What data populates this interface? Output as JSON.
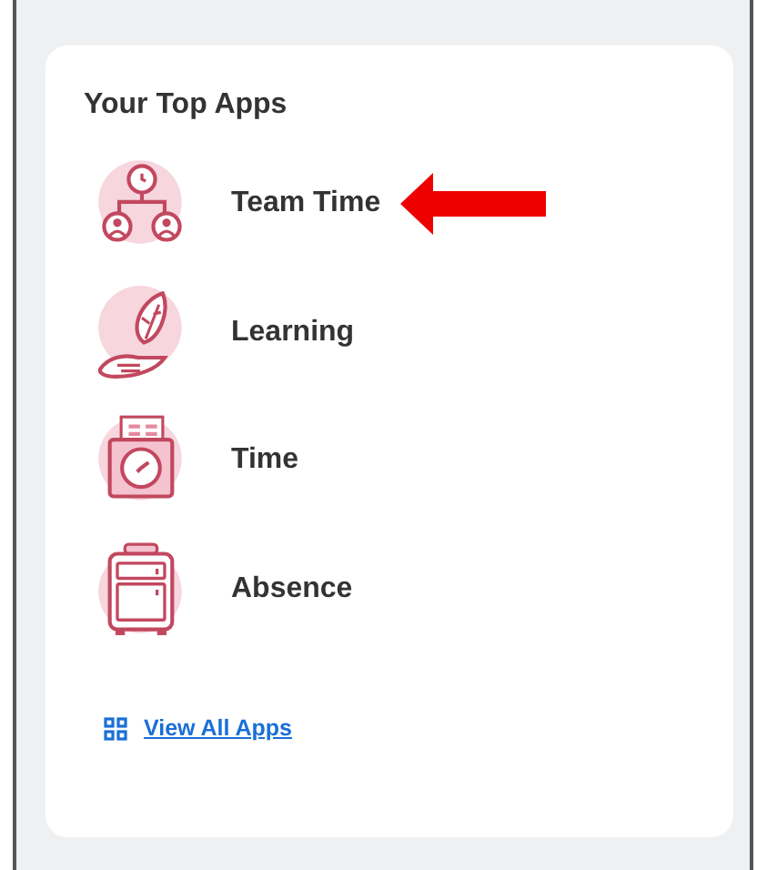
{
  "card": {
    "title": "Your Top Apps",
    "apps": [
      {
        "label": "Team Time",
        "kind": "team",
        "pointed": true
      },
      {
        "label": "Learning",
        "kind": "learning",
        "pointed": false
      },
      {
        "label": "Time",
        "kind": "time",
        "pointed": false
      },
      {
        "label": "Absence",
        "kind": "absence",
        "pointed": false
      }
    ],
    "link": "View All Apps"
  }
}
